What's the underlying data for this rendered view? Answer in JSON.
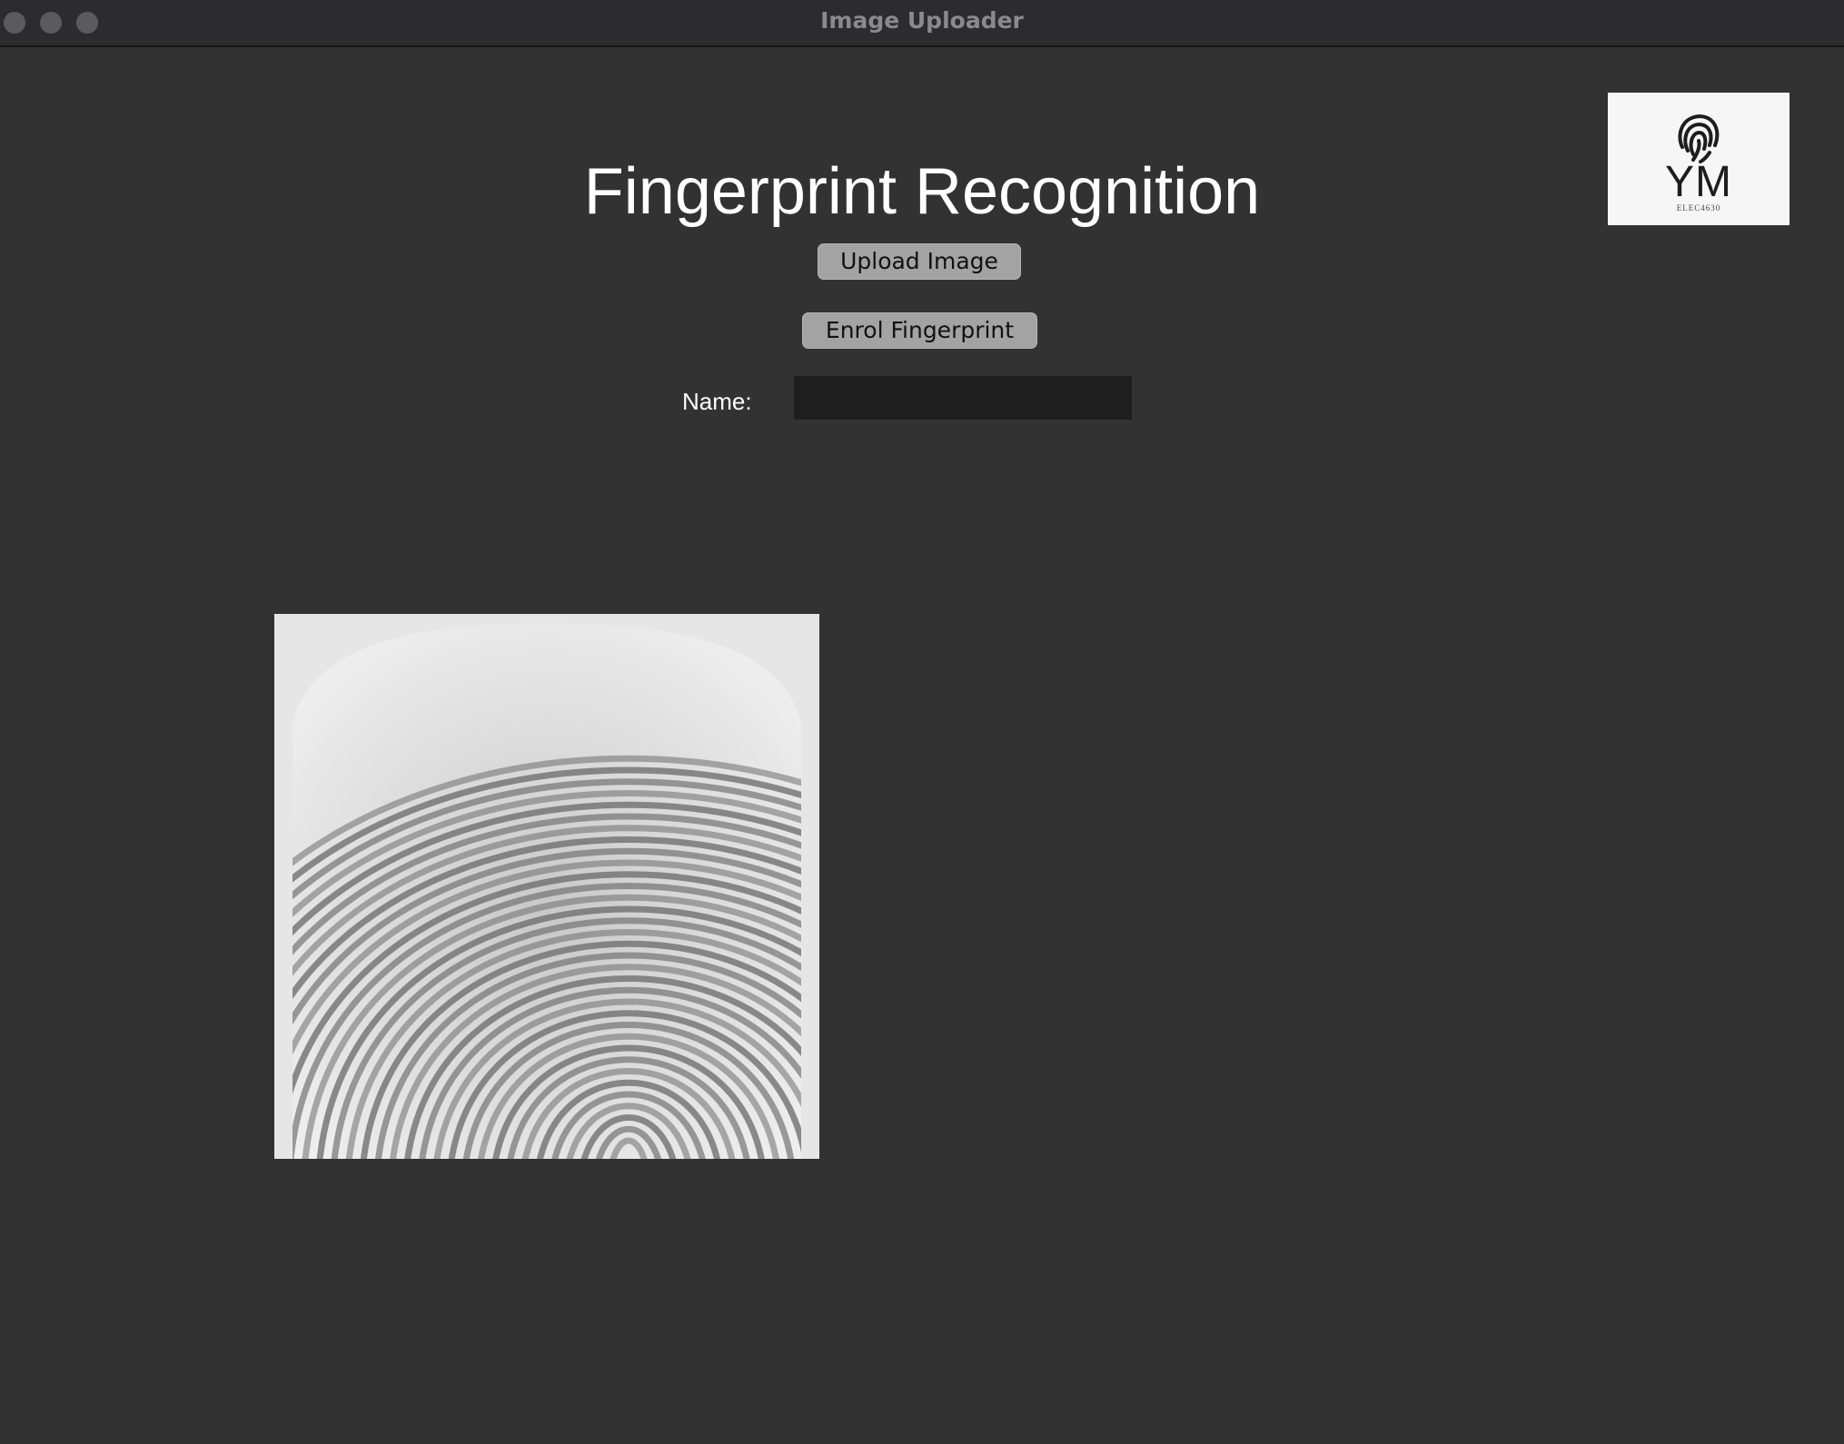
{
  "window": {
    "title": "Image Uploader"
  },
  "app": {
    "title": "Fingerprint Recognition"
  },
  "logo": {
    "icon": "fingerprint-icon",
    "text": "YM",
    "subtext": "ELEC4630"
  },
  "buttons": {
    "upload_label": "Upload Image",
    "enrol_label": "Enrol Fingerprint"
  },
  "name_field": {
    "label": "Name:",
    "value": "",
    "placeholder": ""
  },
  "image": {
    "content": "fingerprint-image"
  },
  "colors": {
    "background": "#323232",
    "titlebar": "#2c2c2e",
    "button": "#a3a3a3",
    "input": "#1e1e1e"
  }
}
